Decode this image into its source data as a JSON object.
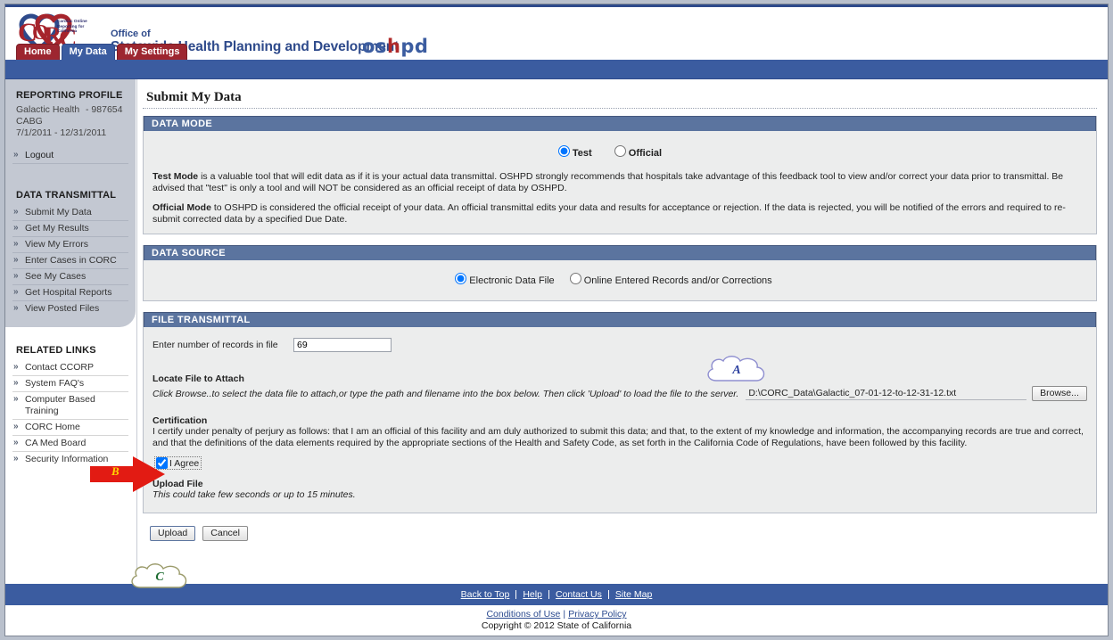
{
  "header": {
    "logo_name": "CORC",
    "logo_tagline": "Cardiac Online Reporting for California",
    "org_line1": "Office of",
    "org_line2": "Statewide Health Planning and Development",
    "oshpd_left": "os",
    "oshpd_h": "h",
    "oshpd_right": "pd",
    "tabs": [
      {
        "label": "Home",
        "active": false
      },
      {
        "label": "My Data",
        "active": true
      },
      {
        "label": "My Settings",
        "active": false
      }
    ]
  },
  "sidebar": {
    "profile_heading": "REPORTING PROFILE",
    "profile_name": "Galactic Health",
    "profile_dash": "-",
    "profile_id": "987654",
    "profile_program": "CABG",
    "profile_period": "7/1/2011 - 12/31/2011",
    "logout_label": "Logout",
    "transmittal_heading": "DATA TRANSMITTAL",
    "transmittal_items": [
      {
        "label": "Submit My Data"
      },
      {
        "label": "Get My Results"
      },
      {
        "label": "View My Errors"
      },
      {
        "label": "Enter Cases in CORC"
      },
      {
        "label": "See My Cases"
      },
      {
        "label": "Get Hospital Reports"
      },
      {
        "label": "View Posted Files"
      }
    ],
    "related_heading": "RELATED LINKS",
    "related_items": [
      {
        "label": "Contact CCORP"
      },
      {
        "label": "System FAQ's"
      },
      {
        "label": "Computer Based Training"
      },
      {
        "label": "CORC Home"
      },
      {
        "label": "CA Med Board"
      },
      {
        "label": "Security Information"
      }
    ],
    "arrow_glyph": "»"
  },
  "main": {
    "page_title": "Submit My Data",
    "data_mode": {
      "panel_title": "DATA MODE",
      "option_test": "Test",
      "option_official": "Official",
      "selected": "Test",
      "paragraph1_bold": "Test Mode",
      "paragraph1": " is a valuable tool that will edit data as if it is your actual data transmittal. OSHPD strongly recommends that hospitals take advantage of this feedback tool to view and/or correct your data prior to transmittal. Be advised that \"test\" is only a tool and will NOT be considered as an official receipt of data by OSHPD.",
      "paragraph2_bold": "Official Mode",
      "paragraph2": " to OSHPD is considered the official receipt of your data. An official transmittal edits your data and results for acceptance or rejection. If the data is rejected, you will be notified of the errors and required to re-submit corrected data by a specified Due Date."
    },
    "data_source": {
      "panel_title": "DATA SOURCE",
      "option_electronic": "Electronic Data File",
      "option_online": "Online Entered Records and/or Corrections",
      "selected": "Electronic Data File"
    },
    "file_transmittal": {
      "panel_title": "FILE TRANSMITTAL",
      "records_label": "Enter number of records in file",
      "records_value": "69",
      "locate_heading": "Locate File to Attach",
      "locate_hint": "Click Browse..to select the data file to attach,or type the path and filename into the box below. Then click 'Upload' to load the file to the server.",
      "file_path": "D:\\CORC_Data\\Galactic_07-01-12-to-12-31-12.txt",
      "browse_label": "Browse...",
      "certification_heading": "Certification",
      "certification_text": "I certify under penalty of perjury as follows: that I am an official of this facility and am duly authorized to submit this data; and that, to the extent of my knowledge and information, the accompanying records are true and correct, and that the definitions of the data elements required by the appropriate sections of the Health and Safety Code, as set forth in the California Code of Regulations, have been followed by this facility.",
      "agree_label": "I Agree",
      "agree_checked": true,
      "upload_heading": "Upload File",
      "upload_note": "This could take few seconds or up to 15 minutes."
    },
    "actions": {
      "upload_label": "Upload",
      "cancel_label": "Cancel"
    }
  },
  "footer": {
    "links": [
      {
        "label": "Back to Top"
      },
      {
        "label": "Help"
      },
      {
        "label": "Contact Us"
      },
      {
        "label": "Site Map"
      }
    ],
    "conditions_label": "Conditions of Use",
    "separator": "|",
    "privacy_label": "Privacy Policy",
    "copyright": "Copyright © 2012 State of California"
  },
  "annotations": {
    "marker_a": "A",
    "marker_b": "B",
    "marker_c": "C"
  },
  "colors": {
    "header_blue": "#2e4a8b",
    "tab_red": "#9d2630",
    "tab_active_blue": "#3b5ca0",
    "panel_head_blue": "#5b749f",
    "panel_body_gray": "#eceded",
    "sidebar_gray": "#c3c8d2",
    "marker_a_color": "#2b3f9e",
    "marker_b_color": "#ffd400",
    "marker_c_color": "#1d6b30",
    "arrow_red": "#e21b13"
  }
}
